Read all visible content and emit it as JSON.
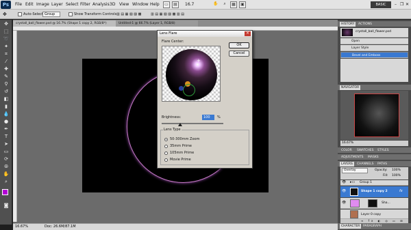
{
  "app": {
    "logo": "Ps",
    "menus": [
      "File",
      "Edit",
      "Image",
      "Layer",
      "Select",
      "Filter",
      "Analysis",
      "3D",
      "View",
      "Window",
      "Help"
    ],
    "zoom_display": "16.7",
    "workspace": "BASIC"
  },
  "options_bar": {
    "auto_select_label": "Auto-Select:",
    "auto_select_value": "Group",
    "transform_controls_label": "Show Transform Controls"
  },
  "tabs": [
    {
      "label": "crystall_ball_flower.psd @ 16.7% (Shape 1 copy 2, RGB/8*)"
    },
    {
      "label": "Untitled-1 @ 66.7% (Layer 1, RGB/8)"
    }
  ],
  "status": {
    "zoom": "16.67%",
    "doc": "Doc: 26.6M/87.1M"
  },
  "dialog": {
    "title": "Lens Flare",
    "flare_center_label": "Flare Center:",
    "ok": "OK",
    "cancel": "Cancel",
    "brightness_label": "Brightness:",
    "brightness_value": "100",
    "brightness_unit": "%",
    "brightness_level": 100,
    "lens_type_label": "Lens Type",
    "lens_types": [
      "50-300mm Zoom",
      "35mm Prime",
      "105mm Prime",
      "Movie Prime"
    ],
    "selected_lens": "50-300mm Zoom"
  },
  "history": {
    "tabs": [
      "HISTORY",
      "ACTIONS"
    ],
    "snapshot": "crystall_ball_flower.psd",
    "items": [
      "Open",
      "Layer Style",
      "Bevel and Emboss"
    ],
    "selected": "Bevel and Emboss"
  },
  "navigator": {
    "tab": "NAVIGATOR",
    "zoom": "16.67%"
  },
  "color_tabs": [
    "COLOR",
    "SWATCHES",
    "STYLES"
  ],
  "adjust_tabs": [
    "ADJUSTMENTS",
    "MASKS"
  ],
  "layers": {
    "tabs": [
      "LAYERS",
      "CHANNELS",
      "PATHS"
    ],
    "blend_mode": "Overlay",
    "opacity_label": "Opacity:",
    "opacity": "100%",
    "fill_label": "Fill:",
    "fill": "100%",
    "items": [
      {
        "name": "Group 1"
      },
      {
        "name": "Shape 1 copy 2"
      },
      {
        "name": "Sha..."
      },
      {
        "name": "Layer 0 copy"
      }
    ]
  },
  "bottom_tabs": [
    "CHARACTER",
    "PARAGRAPH"
  ],
  "colors": {
    "accent": "#3a79d1",
    "ring": "#c87bc9",
    "foreground_swatch": "#b400d6"
  }
}
